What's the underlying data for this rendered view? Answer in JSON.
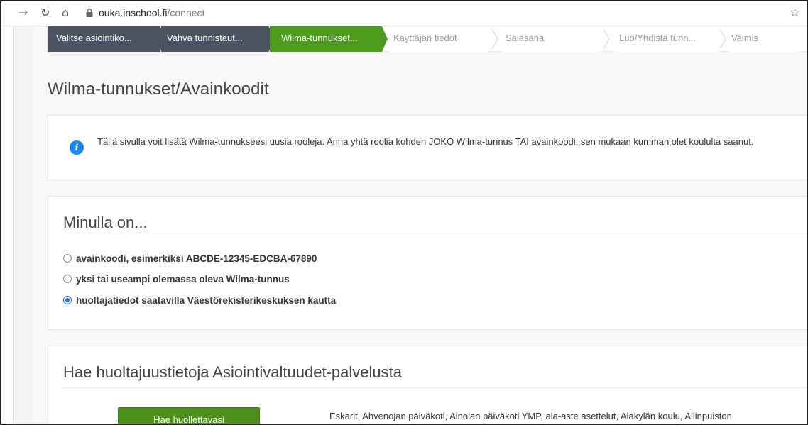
{
  "browser": {
    "url_host": "ouka.inschool.fi",
    "url_path": "/connect"
  },
  "steps": [
    {
      "label": "Valitse asiointiko...",
      "state": "done"
    },
    {
      "label": "Vahva tunnistaut...",
      "state": "done"
    },
    {
      "label": "Wilma-tunnukset...",
      "state": "active"
    },
    {
      "label": "Käyttäjän tiedot",
      "state": "todo"
    },
    {
      "label": "Salasana",
      "state": "todo"
    },
    {
      "label": "Luo/Yhdistä tunn...",
      "state": "todo"
    },
    {
      "label": "Valmis",
      "state": "todo"
    }
  ],
  "page": {
    "title": "Wilma-tunnukset/Avainkoodit",
    "info_text": "Tällä sivulla voit lisätä Wilma-tunnukseesi uusia rooleja. Anna yhtä roolia kohden JOKO Wilma-tunnus TAI avainkoodi, sen mukaan kumman olet koululta saanut."
  },
  "choice": {
    "heading": "Minulla on...",
    "options": [
      {
        "label": "avainkoodi, esimerkiksi ABCDE-12345-EDCBA-67890",
        "checked": false
      },
      {
        "label": "yksi tai useampi olemassa oleva Wilma-tunnus",
        "checked": false
      },
      {
        "label": "huoltajatiedot saatavilla Väestörekisterikeskuksen kautta",
        "checked": true
      }
    ]
  },
  "search": {
    "heading": "Hae huoltajuustietoja Asiointivaltuudet-palvelusta",
    "button_label": "Hae huollettavasi",
    "schools_text": "Eskarit, Ahvenojan päiväkoti, Ainolan päiväkoti YMP, ala-aste asettelut, Alakylän koulu, Allinpuiston"
  },
  "colors": {
    "step_done": "#4a5561",
    "step_active": "#4e9a1f",
    "button": "#4e8f1c",
    "info": "#1e88e5"
  }
}
